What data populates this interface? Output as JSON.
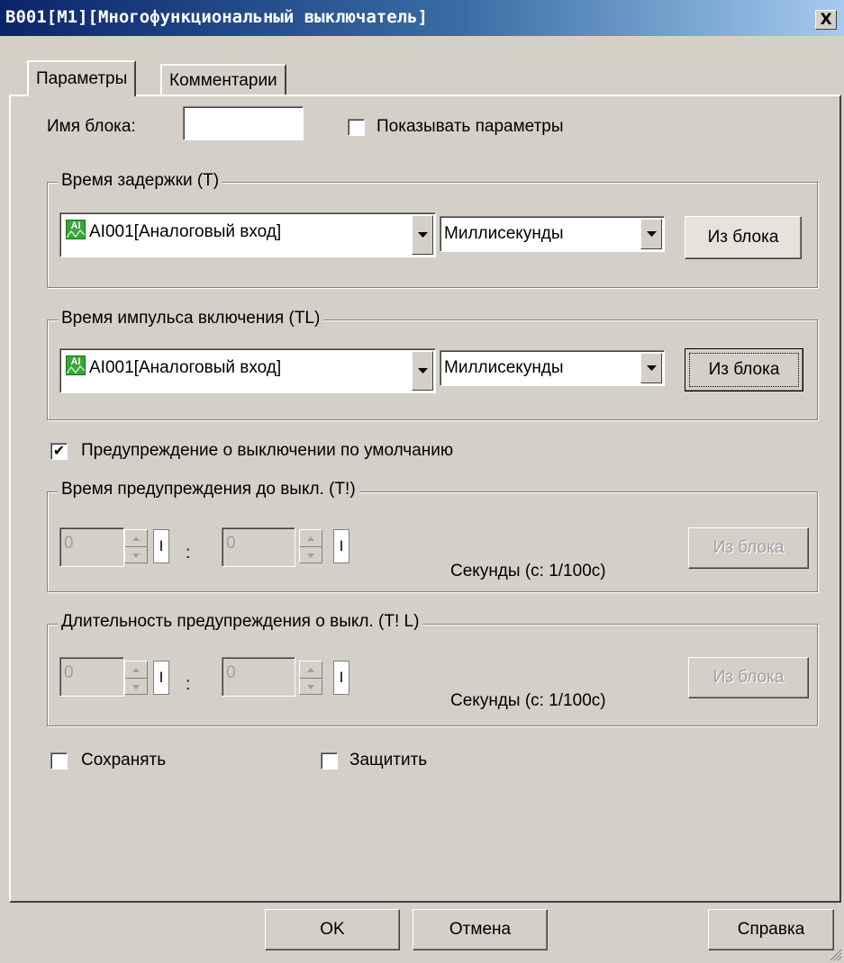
{
  "window": {
    "title": "B001[M1][Многофункциональный выключатель]",
    "close_label": "X"
  },
  "tabs": [
    {
      "label": "Параметры",
      "active": true
    },
    {
      "label": "Комментарии",
      "active": false
    }
  ],
  "block_name": {
    "label": "Имя блока:",
    "value": ""
  },
  "show_params": {
    "label": "Показывать параметры",
    "checked": false
  },
  "delay_group": {
    "title": "Время задержки (T)",
    "source": {
      "icon": "analog-input-icon",
      "icon_text": "AI",
      "value": "AI001[Аналоговый вход]"
    },
    "unit": {
      "value": "Миллисекунды"
    },
    "from_block_label": "Из блока"
  },
  "pulse_group": {
    "title": "Время импульса включения (TL)",
    "source": {
      "icon": "analog-input-icon",
      "icon_text": "AI",
      "value": "AI001[Аналоговый вход]"
    },
    "unit": {
      "value": "Миллисекунды"
    },
    "from_block_label": "Из блока"
  },
  "warning_default": {
    "label": "Предупреждение о выключении по умолчанию",
    "checked": true
  },
  "warn_time_group": {
    "title": "Время предупреждения до выкл. (T!)",
    "seconds": "0",
    "hundredths": "0",
    "bar_label": "I",
    "colon": ":",
    "unit_label": "Секунды (с: 1/100с)",
    "from_block_label": "Из блока"
  },
  "warn_duration_group": {
    "title": "Длительность предупреждения о выкл. (T! L)",
    "seconds": "0",
    "hundredths": "0",
    "bar_label": "I",
    "colon": ":",
    "unit_label": "Секунды (с: 1/100с)",
    "from_block_label": "Из блока"
  },
  "retentive": {
    "label": "Сохранять",
    "checked": false
  },
  "protect": {
    "label": "Защитить",
    "checked": false
  },
  "footer": {
    "ok_label": "OK",
    "cancel_label": "Отмена",
    "help_label": "Справка"
  },
  "colors": {
    "face": "#d4d0c8",
    "title_start": "#0a246a",
    "title_end": "#a6caf0",
    "ai_icon": "#3aa43a",
    "disabled_text": "#a0a0a0"
  }
}
